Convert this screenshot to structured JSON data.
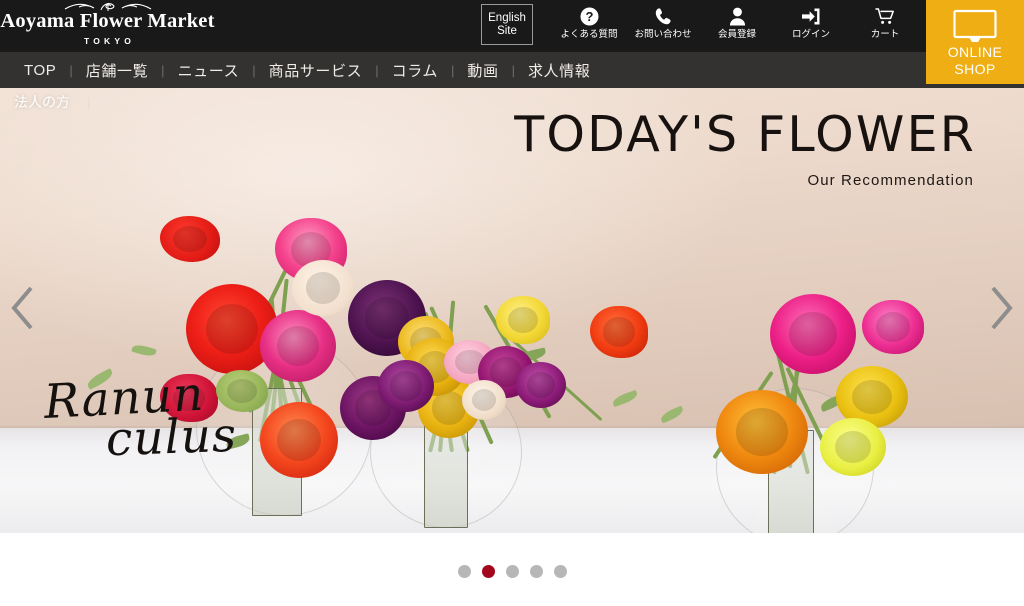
{
  "site": {
    "logo_name": "Aoyama Flower Market",
    "logo_sub": "TOKYO",
    "flourish_icon": "ornament-flourish-icon"
  },
  "header": {
    "english_site": {
      "line1": "English",
      "line2": "Site"
    },
    "utilities": [
      {
        "icon": "question-circle-icon",
        "label": "よくある質問"
      },
      {
        "icon": "phone-icon",
        "label": "お問い合わせ"
      },
      {
        "icon": "person-icon",
        "label": "会員登録"
      },
      {
        "icon": "login-arrow-icon",
        "label": "ログイン"
      },
      {
        "icon": "cart-icon",
        "label": "カート"
      }
    ],
    "online_shop": {
      "icon": "monitor-icon",
      "line1": "ONLINE",
      "line2": "SHOP",
      "color": "#efae13"
    }
  },
  "mainnav": {
    "separator": "|",
    "items": [
      {
        "label": "TOP"
      },
      {
        "label": "店舗一覧"
      },
      {
        "label": "ニュース"
      },
      {
        "label": "商品サービス"
      },
      {
        "label": "コラム"
      },
      {
        "label": "動画"
      },
      {
        "label": "求人情報"
      }
    ]
  },
  "hero": {
    "corporate_link": "法人の方",
    "corporate_separator": "|",
    "title": "TODAY'S FLOWER",
    "subtitle": "Our Recommendation",
    "script_line1": "Ranun",
    "script_line2": "culus",
    "prev_icon": "chevron-left-icon",
    "next_icon": "chevron-right-icon",
    "alt": "Ranunculus flower arrangement in three glass vases on a white table"
  },
  "carousel": {
    "total": 5,
    "active_index": 2,
    "active_color": "#a3071c",
    "inactive_color": "#b7b7b7"
  }
}
